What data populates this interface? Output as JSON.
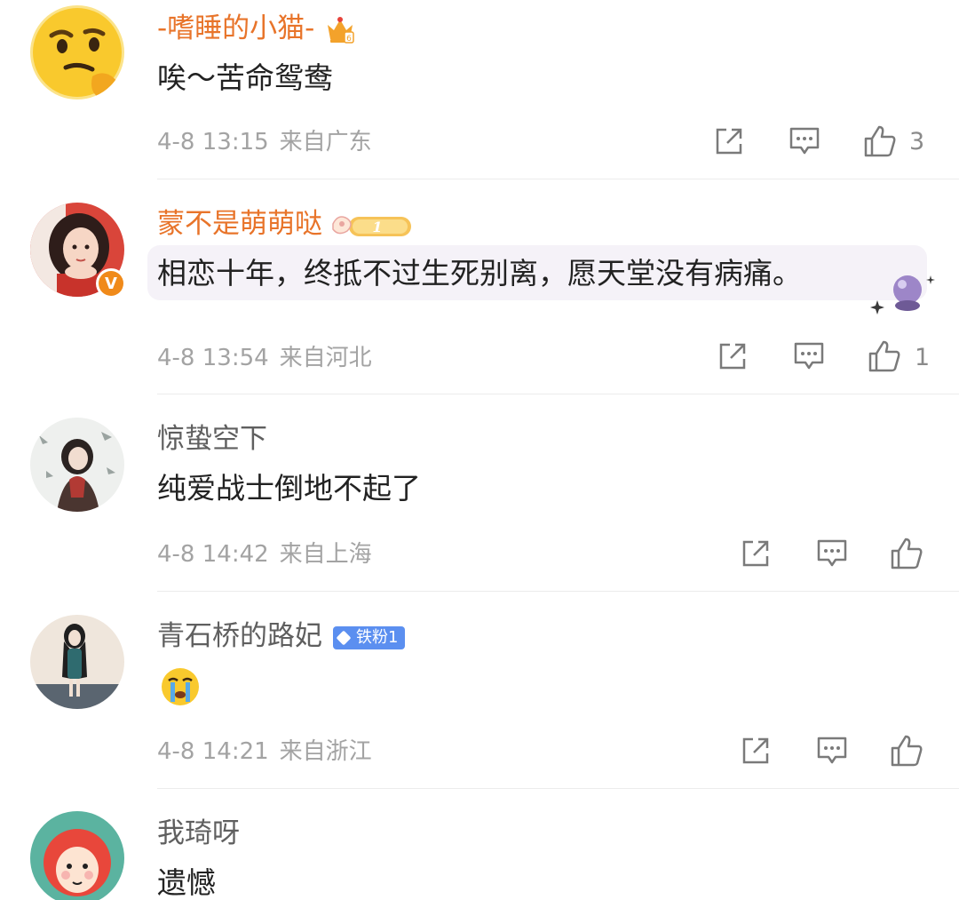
{
  "comments": [
    {
      "user": "-嗜睡的小猫-",
      "text": "唉～苦命鸳鸯",
      "time": "4-8 13:15",
      "location": "来自广东",
      "likes": "3",
      "avatar_icon": "thinking-emoji-avatar",
      "badge_icon": "crown-level-icon"
    },
    {
      "user": "蒙不是萌萌哒",
      "text": "相恋十年，终抵不过生死别离，愿天堂没有病痛。",
      "time": "4-8 13:54",
      "location": "来自河北",
      "likes": "1",
      "avatar_icon": "girl-portrait-avatar",
      "badge_icon": "fan-level-badge-icon",
      "fan_level": "1",
      "verified_mark": "V"
    },
    {
      "user": "惊蛰空下",
      "text": "纯爱战士倒地不起了",
      "time": "4-8 14:42",
      "location": "来自上海",
      "likes": "",
      "avatar_icon": "illustrated-girl-avatar"
    },
    {
      "user": "青石桥的路妃",
      "text_icon": "crying-face-emoji",
      "time": "4-8 14:21",
      "location": "来自浙江",
      "likes": "",
      "avatar_icon": "standing-girl-avatar",
      "badge_label": "铁粉1",
      "badge_icon": "diamond-icon"
    },
    {
      "user": "我琦呀",
      "text": "遗憾",
      "avatar_icon": "cartoon-kid-avatar"
    }
  ],
  "colors": {
    "username_highlight": "#e8742a",
    "username_normal": "#5f5f5f",
    "meta_gray": "#a3a3a3",
    "fan_badge_blue": "#5b8ff0"
  },
  "actions": [
    "share-icon",
    "comment-icon",
    "like-icon"
  ]
}
